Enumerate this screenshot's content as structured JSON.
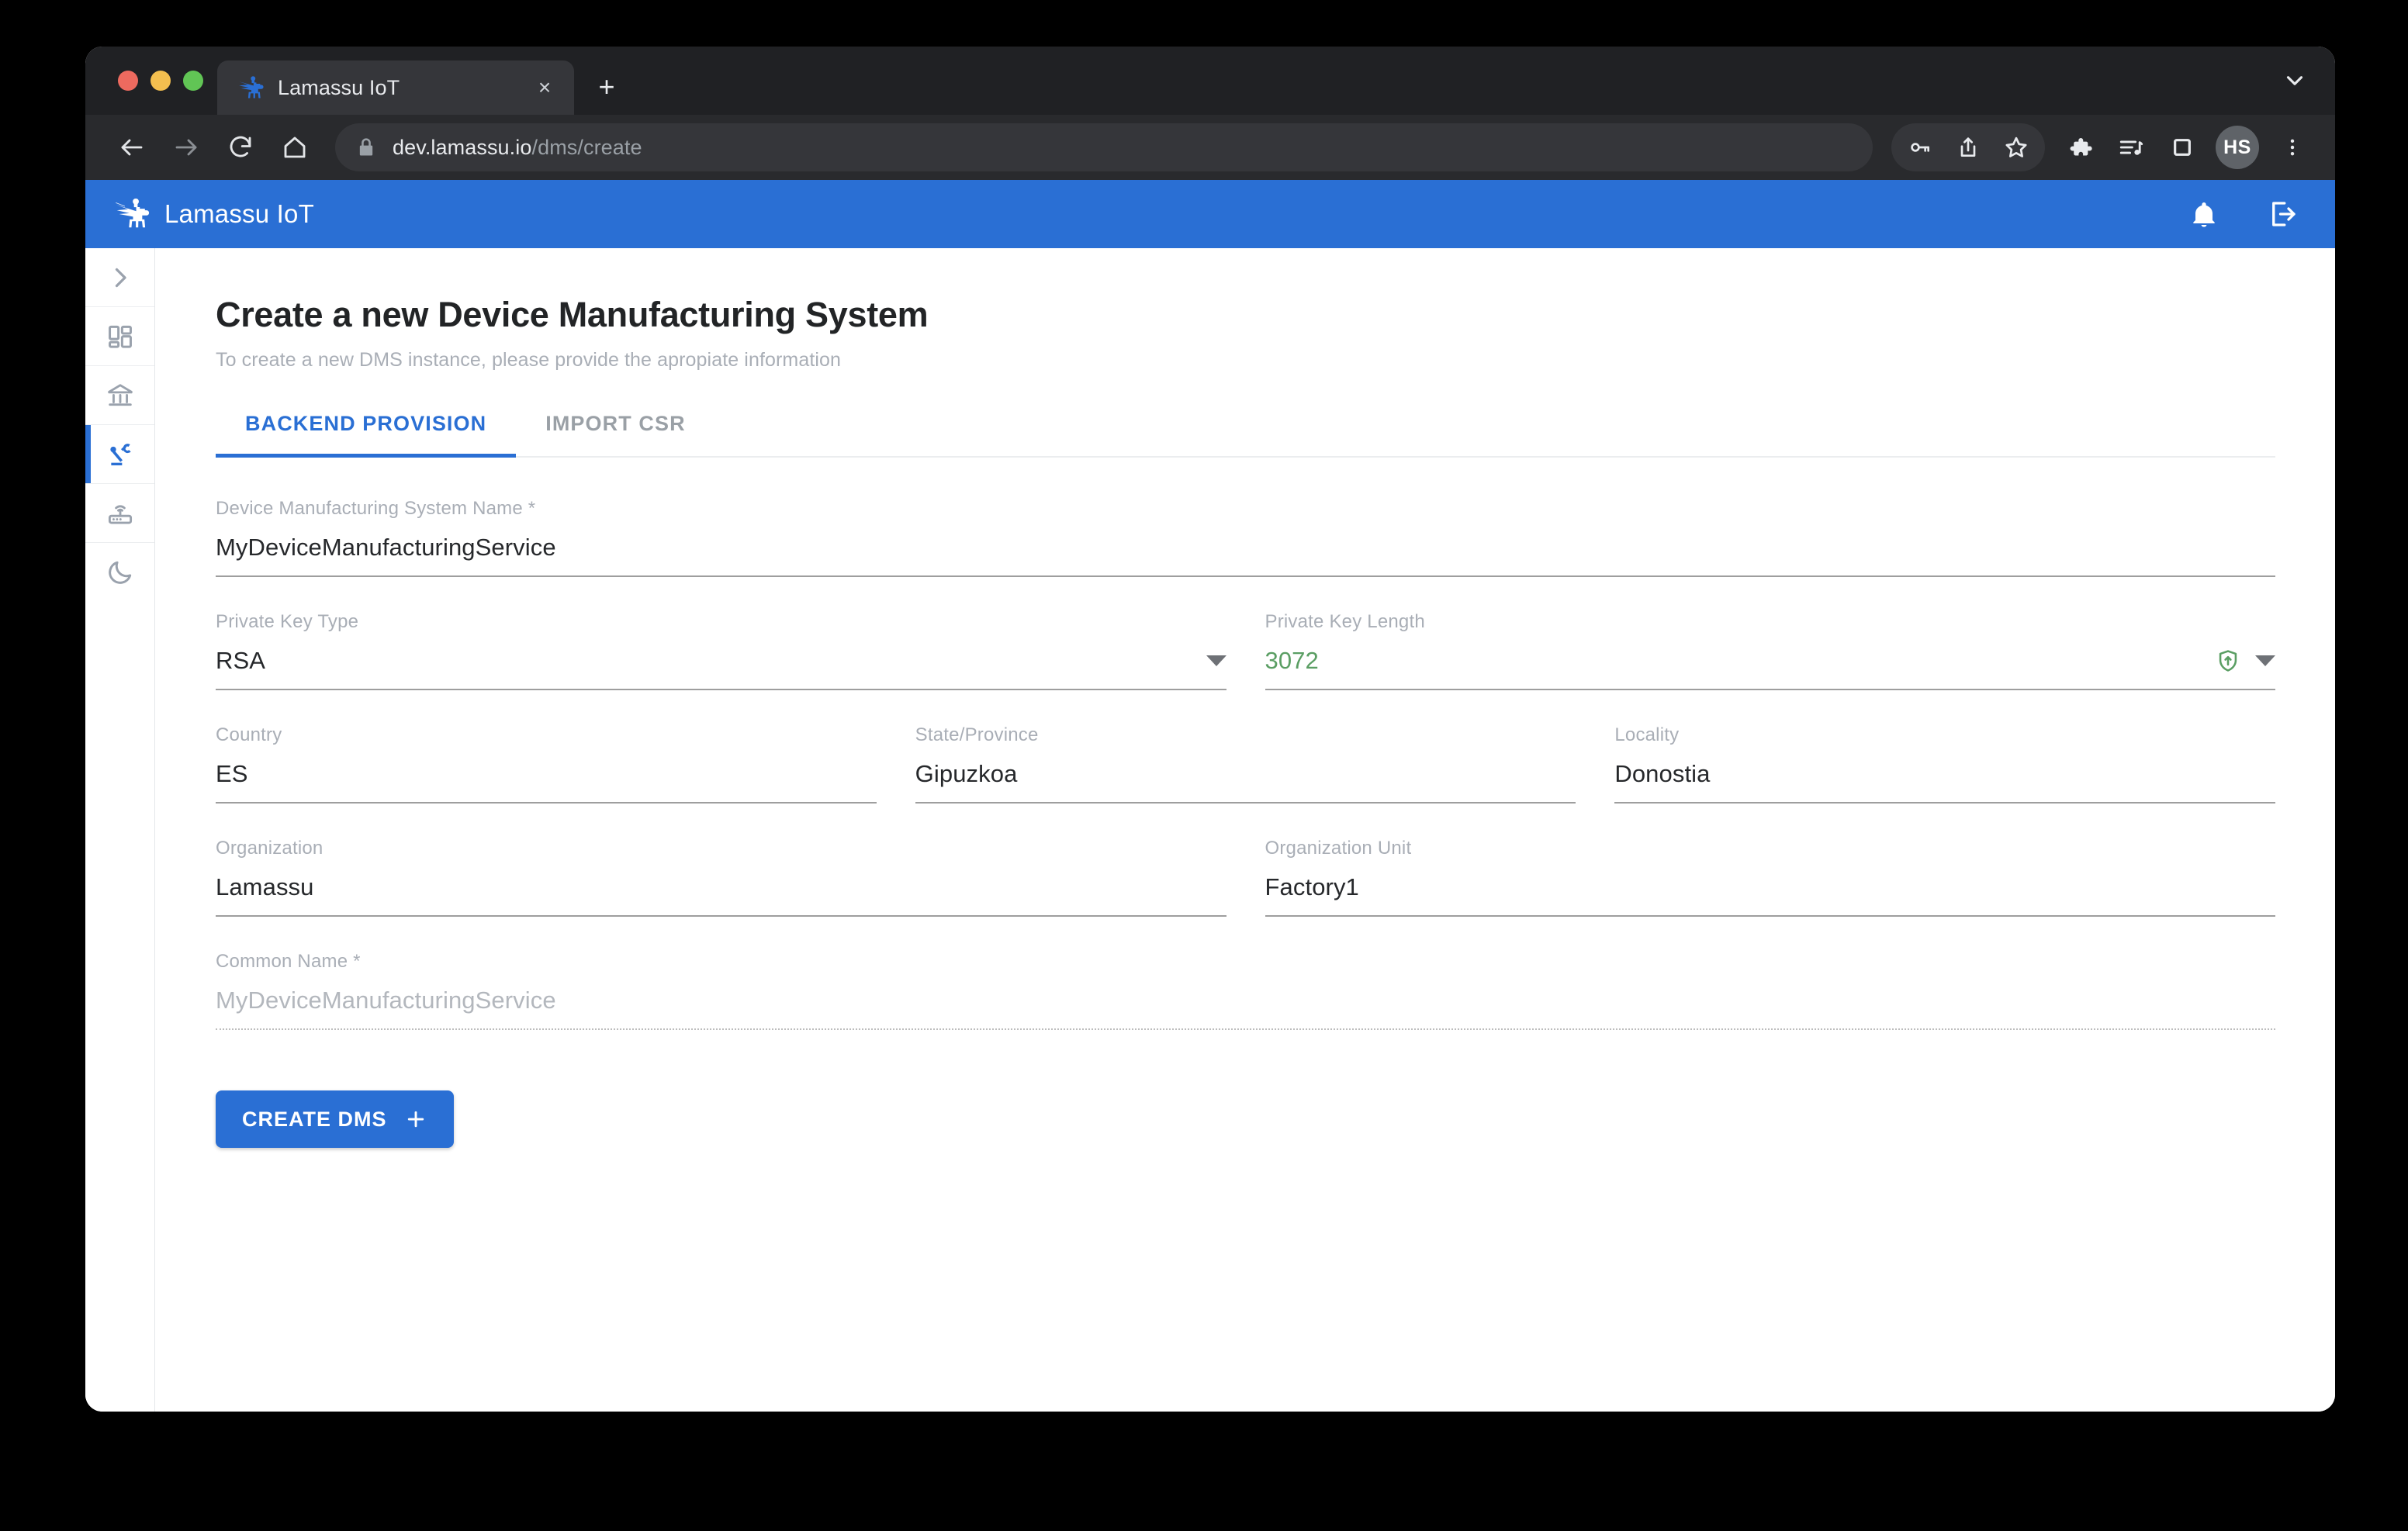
{
  "browser": {
    "traffic_lights": [
      "close",
      "minimize",
      "maximize"
    ],
    "tab": {
      "title": "Lamassu IoT",
      "favicon": "lamassu-favicon",
      "close_label": "×"
    },
    "new_tab_label": "+",
    "toolbar": {
      "back": "←",
      "forward": "→",
      "reload": "⟳",
      "home": "⌂",
      "url_domain": "dev.lamassu.io",
      "url_path": "/dms/create",
      "lock_icon": "lock-icon",
      "icons": [
        "key-icon",
        "share-icon",
        "bookmark-star-icon",
        "extensions-puzzle-icon",
        "media-playlist-icon",
        "side-panel-icon"
      ],
      "profile_initials": "HS",
      "menu_icon": "three-dot-menu-icon"
    }
  },
  "appbar": {
    "brand": "Lamassu IoT",
    "actions": [
      "notifications-bell-icon",
      "logout-icon"
    ]
  },
  "sidebar": {
    "items": [
      {
        "name": "expand",
        "icon": "chevron-right-icon",
        "active": false
      },
      {
        "name": "dashboard",
        "icon": "dashboard-grid-icon",
        "active": false
      },
      {
        "name": "certificate-authorities",
        "icon": "bank-icon",
        "active": false
      },
      {
        "name": "device-manufacturing-systems",
        "icon": "robot-arm-icon",
        "active": true
      },
      {
        "name": "devices",
        "icon": "router-icon",
        "active": false
      },
      {
        "name": "dark-mode",
        "icon": "moon-icon",
        "active": false
      }
    ]
  },
  "page": {
    "title": "Create a new Device Manufacturing System",
    "subtitle": "To create a new DMS instance, please provide the apropiate information",
    "tabs": [
      {
        "label": "BACKEND PROVISION",
        "active": true
      },
      {
        "label": "IMPORT CSR",
        "active": false
      }
    ],
    "submit_label": "CREATE DMS",
    "submit_icon": "plus-icon"
  },
  "form": {
    "dms_name": {
      "label": "Device Manufacturing System Name *",
      "value": "MyDeviceManufacturingService"
    },
    "private_key_type": {
      "label": "Private Key Type",
      "value": "RSA",
      "icon": "chevron-down-icon"
    },
    "private_key_length": {
      "label": "Private Key Length",
      "value": "3072",
      "status_icon": "shield-strength-icon",
      "icon": "chevron-down-icon"
    },
    "country": {
      "label": "Country",
      "value": "ES"
    },
    "state": {
      "label": "State/Province",
      "value": "Gipuzkoa"
    },
    "locality": {
      "label": "Locality",
      "value": "Donostia"
    },
    "organization": {
      "label": "Organization",
      "value": "Lamassu"
    },
    "organization_unit": {
      "label": "Organization Unit",
      "value": "Factory1"
    },
    "common_name": {
      "label": "Common Name *",
      "value": "MyDeviceManufacturingService"
    }
  },
  "colors": {
    "brand_blue": "#2a6fd4",
    "key_length_green": "#5a9e63",
    "muted_label": "#a9aeb6"
  }
}
